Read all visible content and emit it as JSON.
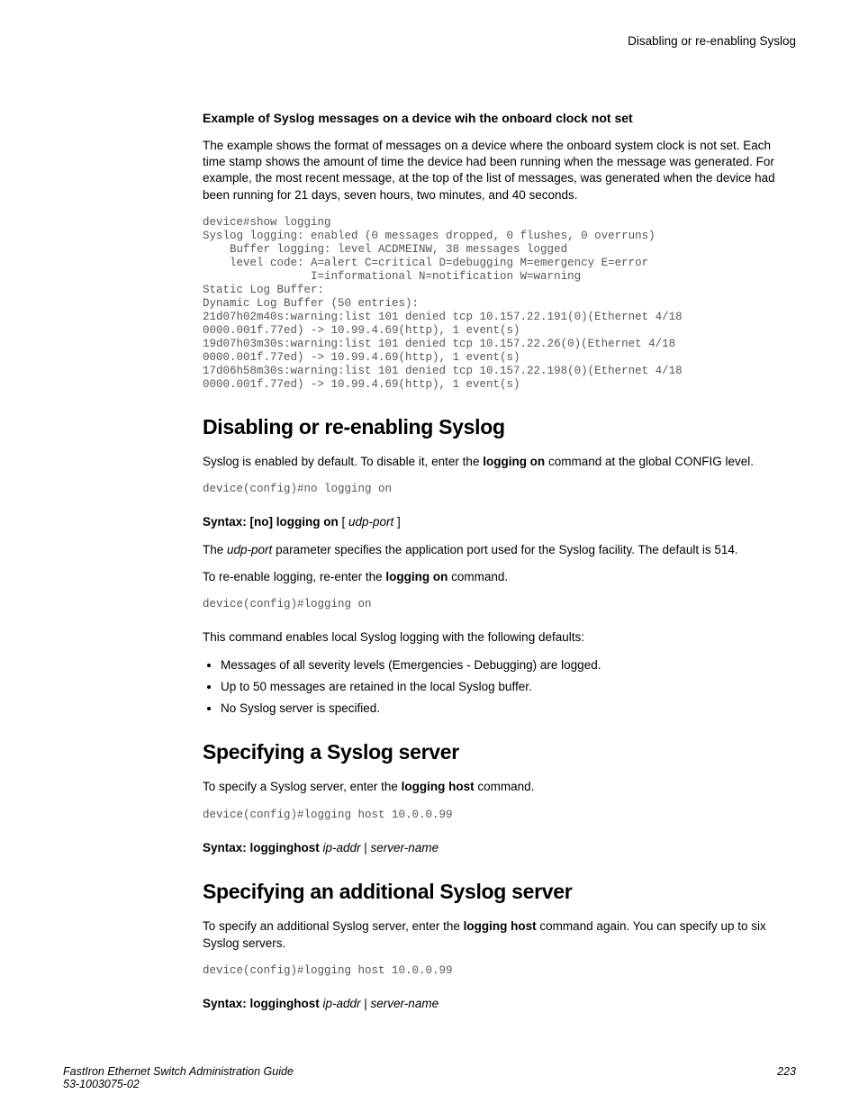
{
  "header": {
    "right": "Disabling or re-enabling Syslog"
  },
  "section1": {
    "heading": "Example of Syslog messages on a device wih the onboard clock not set",
    "para1": "The example shows the format of messages on a device where the onboard system clock is not set. Each time stamp shows the amount of time the device had been running when the message was generated. For example, the most recent message, at the top of the list of messages, was generated when the device had been running for 21 days, seven hours, two minutes, and 40 seconds.",
    "code": "device#show logging\nSyslog logging: enabled (0 messages dropped, 0 flushes, 0 overruns)\n    Buffer logging: level ACDMEINW, 38 messages logged\n    level code: A=alert C=critical D=debugging M=emergency E=error\n                I=informational N=notification W=warning\nStatic Log Buffer:\nDynamic Log Buffer (50 entries):\n21d07h02m40s:warning:list 101 denied tcp 10.157.22.191(0)(Ethernet 4/18 \n0000.001f.77ed) -> 10.99.4.69(http), 1 event(s)\n19d07h03m30s:warning:list 101 denied tcp 10.157.22.26(0)(Ethernet 4/18 \n0000.001f.77ed) -> 10.99.4.69(http), 1 event(s)\n17d06h58m30s:warning:list 101 denied tcp 10.157.22.198(0)(Ethernet 4/18 \n0000.001f.77ed) -> 10.99.4.69(http), 1 event(s)"
  },
  "section2": {
    "heading": "Disabling or re-enabling Syslog",
    "para1_a": "Syslog is enabled by default. To disable it, enter the ",
    "para1_b": "logging on",
    "para1_c": " command at the global CONFIG level.",
    "code1": "device(config)#no logging on",
    "syntax_a": "Syntax: [no] logging on",
    "syntax_b": " [ ",
    "syntax_c": "udp-port",
    "syntax_d": " ]",
    "para2_a": "The ",
    "para2_b": "udp-port",
    "para2_c": " parameter specifies the application port used for the Syslog facility. The default is 514.",
    "para3_a": "To re-enable logging, re-enter the ",
    "para3_b": "logging on",
    "para3_c": " command.",
    "code2": "device(config)#logging on",
    "para4": "This command enables local Syslog logging with the following defaults:",
    "bullet1": "Messages of all severity levels (Emergencies - Debugging) are logged.",
    "bullet2": "Up to 50 messages are retained in the local Syslog buffer.",
    "bullet3": "No Syslog server is specified."
  },
  "section3": {
    "heading": "Specifying a Syslog server",
    "para1_a": "To specify a Syslog server, enter the ",
    "para1_b": "logging host",
    "para1_c": " command.",
    "code": "device(config)#logging host 10.0.0.99",
    "syntax_a": "Syntax: logginghost",
    "syntax_b": " ip-addr",
    "syntax_c": " | ",
    "syntax_d": "server-name"
  },
  "section4": {
    "heading": "Specifying an additional Syslog server",
    "para1_a": "To specify an additional Syslog server, enter the ",
    "para1_b": "logging host",
    "para1_c": " command again. You can specify up to six Syslog servers.",
    "code": "device(config)#logging host 10.0.0.99",
    "syntax_a": "Syntax: logginghost",
    "syntax_b": " ip-addr",
    "syntax_c": " | ",
    "syntax_d": "server-name"
  },
  "footer": {
    "title": "FastIron Ethernet Switch Administration Guide",
    "docnum": "53-1003075-02",
    "page": "223"
  }
}
